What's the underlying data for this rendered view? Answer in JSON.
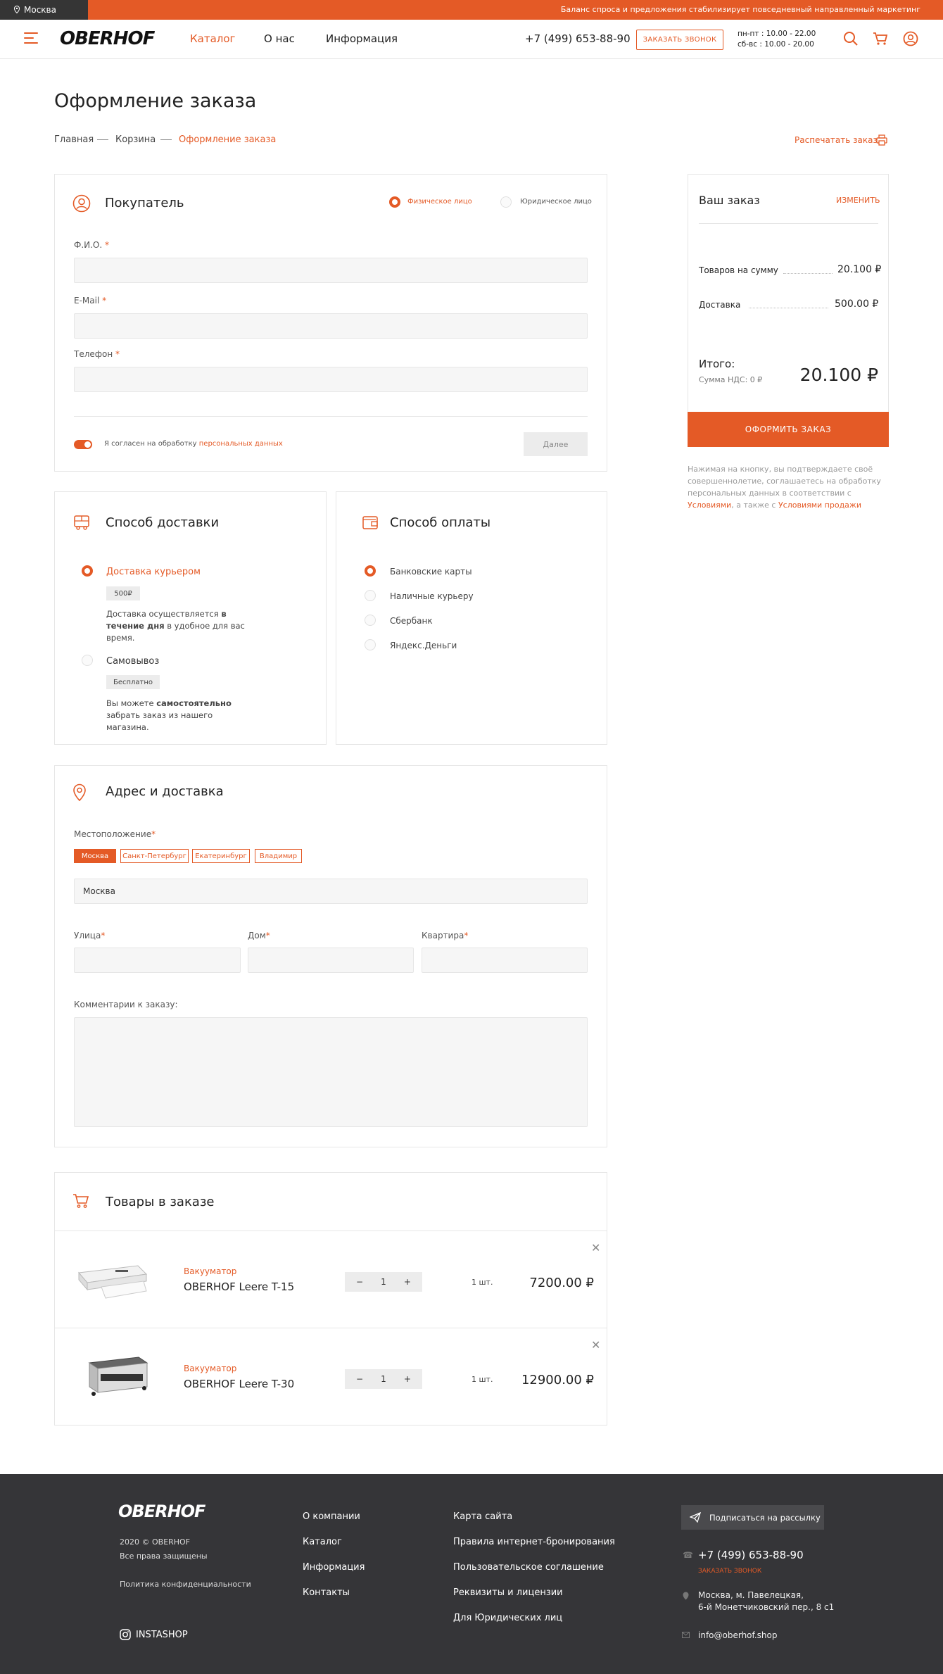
{
  "topbar": {
    "city": "Москва",
    "ticker": "Баланс спроса и предложения стабилизирует повседневный направленный маркетинг"
  },
  "header": {
    "logo": "OBERHOF",
    "nav": [
      "Каталог",
      "О нас",
      "Информация"
    ],
    "phone": "+7 (499) 653-88-90",
    "call_button": "ЗАКАЗАТЬ ЗВОНОК",
    "hours_weekday": "пн-пт : 10.00 - 22.00",
    "hours_weekend": "сб-вс : 10.00 - 20.00"
  },
  "page": {
    "title": "Оформление заказа",
    "breadcrumbs": [
      "Главная",
      "Корзина",
      "Оформление заказа"
    ],
    "print_link": "Распечатать заказ"
  },
  "buyer": {
    "title": "Покупатель",
    "type_individual": "Физическое лицо",
    "type_legal": "Юридическое лицо",
    "fio_label": "Ф.И.О.",
    "email_label": "E-Mail",
    "phone_label": "Телефон",
    "required_mark": "*",
    "consent_text": "Я согласен на обработку",
    "consent_link": "персональных данных",
    "next_button": "Далее"
  },
  "delivery": {
    "title": "Способ доставки",
    "options": [
      {
        "label": "Доставка курьером",
        "tag": "500₽",
        "desc_pre": "Доставка осуществляется ",
        "desc_bold": "в течение дня",
        "desc_post": " в удобное для вас время."
      },
      {
        "label": "Самовывоз",
        "tag": "Бесплатно",
        "desc_pre": "Вы можете ",
        "desc_bold": "самостоятельно",
        "desc_post": " забрать заказ из нашего магазина."
      }
    ]
  },
  "payment": {
    "title": "Способ оплаты",
    "options": [
      "Банковские карты",
      "Наличные курьеру",
      "Сбербанк",
      "Яндекс.Деньги"
    ]
  },
  "address": {
    "title": "Адрес и доставка",
    "location_label": "Местоположение",
    "cities": [
      "Москва",
      "Санкт-Петербург",
      "Екатеринбург",
      "Владимир"
    ],
    "location_value": "Москва",
    "street_label": "Улица",
    "house_label": "Дом",
    "apt_label": "Квартира",
    "comment_label": "Комментарии к заказу:"
  },
  "products": {
    "title": "Товары в заказе",
    "items": [
      {
        "category": "Вакууматор",
        "name": "OBERHOF Leere T-15",
        "qty": "1",
        "qty_text": "1 шт.",
        "price": "7200.00 ₽"
      },
      {
        "category": "Вакууматор",
        "name": "OBERHOF Leere T-30",
        "qty": "1",
        "qty_text": "1 шт.",
        "price": "12900.00 ₽"
      }
    ]
  },
  "summary": {
    "title": "Ваш заказ",
    "change": "ИЗМЕНИТЬ",
    "goods_label": "Товаров на сумму",
    "goods_value": "20.100 ₽",
    "delivery_label": "Доставка",
    "delivery_value": "500.00 ₽",
    "total_label": "Итого:",
    "vat": "Сумма НДС: 0 ₽",
    "total_value": "20.100 ₽",
    "submit": "ОФОРМИТЬ ЗАКАЗ",
    "note_1": "Нажимая на кнопку, вы подтверждаете своё совершеннолетие, соглашаетесь на обработку персональных данных в соответствии с",
    "note_link1": "Условиями",
    "note_2": ", а также с",
    "note_link2": "Условиями продажи"
  },
  "footer": {
    "logo": "OBERHOF",
    "copyright": "2020 © OBERHOF",
    "rights": "Все права защищены",
    "privacy": "Политика конфиденциальности",
    "insta": "INSTASHOP",
    "col1": [
      "О компании",
      "Каталог",
      "Информация",
      "Контакты"
    ],
    "col2": [
      "Карта сайта",
      "Правила интернет-бронирования",
      "Пользовательское соглашение",
      "Реквизиты и лицензии",
      "Для Юридических лиц"
    ],
    "subscribe": "Подписаться на рассылку",
    "phone": "+7 (499) 653-88-90",
    "call": "ЗАКАЗАТЬ ЗВОНОК",
    "address_1": "Москва, м. Павелецкая,",
    "address_2": "6-й Монетчиковский пер., 8 с1",
    "email": "info@oberhof.shop"
  }
}
